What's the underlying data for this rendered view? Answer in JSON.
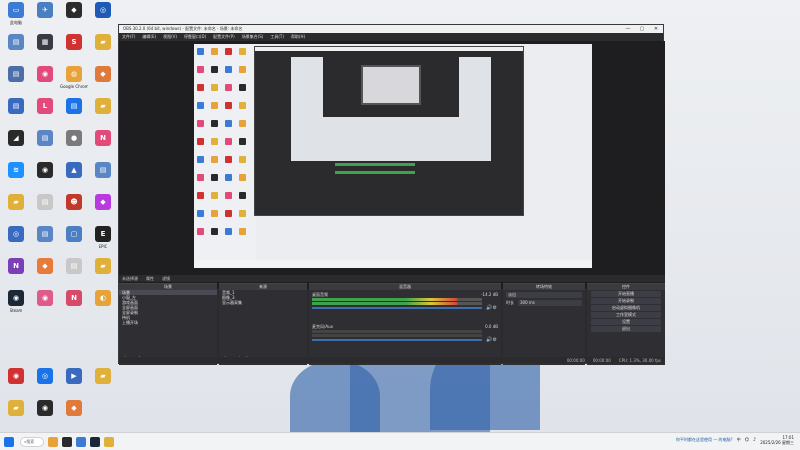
{
  "desktop": {
    "icons": [
      {
        "label": "此电脑",
        "color": "#3b7bd4",
        "glyph": "▭",
        "icon": "computer-icon"
      },
      {
        "label": "",
        "color": "#4a7fc1",
        "glyph": "✈",
        "icon": "app-icon"
      },
      {
        "label": "",
        "color": "#2c2c2c",
        "glyph": "◆",
        "icon": "app-icon"
      },
      {
        "label": "",
        "color": "#1e5bb8",
        "glyph": "◎",
        "icon": "app-icon"
      },
      {
        "label": "",
        "color": "#5a86c5",
        "glyph": "▤",
        "icon": "app-icon"
      },
      {
        "label": "",
        "color": "#3a3a44",
        "glyph": "▦",
        "icon": "app-icon"
      },
      {
        "label": "",
        "color": "#d03232",
        "glyph": "S",
        "icon": "app-icon"
      },
      {
        "label": "",
        "color": "#e0b13a",
        "glyph": "▰",
        "icon": "folder-icon"
      },
      {
        "label": "",
        "color": "#4d6fa8",
        "glyph": "▤",
        "icon": "app-icon"
      },
      {
        "label": "",
        "color": "#e24a7a",
        "glyph": "◉",
        "icon": "app-icon"
      },
      {
        "label": "Google Chrome",
        "color": "#e8a23a",
        "glyph": "◍",
        "icon": "chrome-icon"
      },
      {
        "label": "",
        "color": "#e07a3a",
        "glyph": "◆",
        "icon": "app-icon"
      },
      {
        "label": "",
        "color": "#3a6ac0",
        "glyph": "▤",
        "icon": "app-icon"
      },
      {
        "label": "",
        "color": "#e24a7a",
        "glyph": "L",
        "icon": "app-icon"
      },
      {
        "label": "",
        "color": "#1a73e8",
        "glyph": "▤",
        "icon": "app-icon"
      },
      {
        "label": "",
        "color": "#e0b13a",
        "glyph": "▰",
        "icon": "folder-icon"
      },
      {
        "label": "",
        "color": "#2a2a2a",
        "glyph": "◢",
        "icon": "app-icon"
      },
      {
        "label": "",
        "color": "#5a86c5",
        "glyph": "▤",
        "icon": "app-icon"
      },
      {
        "label": "",
        "color": "#7a7a7a",
        "glyph": "●",
        "icon": "app-icon"
      },
      {
        "label": "",
        "color": "#e24a7a",
        "glyph": "N",
        "icon": "app-icon"
      },
      {
        "label": "",
        "color": "#1e90ff",
        "glyph": "≋",
        "icon": "app-icon"
      },
      {
        "label": "",
        "color": "#2a2a2a",
        "glyph": "◉",
        "icon": "app-icon"
      },
      {
        "label": "",
        "color": "#3a6ac0",
        "glyph": "▲",
        "icon": "app-icon"
      },
      {
        "label": "",
        "color": "#5a86c5",
        "glyph": "▤",
        "icon": "app-icon"
      },
      {
        "label": "",
        "color": "#e0b13a",
        "glyph": "▰",
        "icon": "folder-icon"
      },
      {
        "label": "",
        "color": "#c8c8c8",
        "glyph": "▤",
        "icon": "file-icon"
      },
      {
        "label": "",
        "color": "#c0392b",
        "glyph": "☻",
        "icon": "app-icon"
      },
      {
        "label": "",
        "color": "#b83be0",
        "glyph": "◆",
        "icon": "app-icon"
      },
      {
        "label": "",
        "color": "#3a6ac0",
        "glyph": "◎",
        "icon": "app-icon"
      },
      {
        "label": "",
        "color": "#5a86c5",
        "glyph": "▤",
        "icon": "app-icon"
      },
      {
        "label": "",
        "color": "#4a7fc1",
        "glyph": "▢",
        "icon": "app-icon"
      },
      {
        "label": "EPIC",
        "color": "#222",
        "glyph": "E",
        "icon": "epic-games-icon"
      },
      {
        "label": "",
        "color": "#7b3fb8",
        "glyph": "N",
        "icon": "app-icon"
      },
      {
        "label": "",
        "color": "#e87a3a",
        "glyph": "◆",
        "icon": "app-icon"
      },
      {
        "label": "",
        "color": "#c8c8c8",
        "glyph": "▤",
        "icon": "file-icon"
      },
      {
        "label": "",
        "color": "#e0b13a",
        "glyph": "▰",
        "icon": "folder-icon"
      },
      {
        "label": "Steam",
        "color": "#1b2838",
        "glyph": "◉",
        "icon": "steam-icon"
      },
      {
        "label": "",
        "color": "#e05a8a",
        "glyph": "◉",
        "icon": "app-icon"
      },
      {
        "label": "",
        "color": "#d84a6a",
        "glyph": "N",
        "icon": "app-icon"
      },
      {
        "label": "",
        "color": "#e8a23a",
        "glyph": "◐",
        "icon": "app-icon"
      }
    ],
    "left_column": [
      {
        "label": "",
        "color": "#d03232",
        "glyph": "◉",
        "icon": "app-icon"
      },
      {
        "label": "",
        "color": "#1a73e8",
        "glyph": "◎",
        "icon": "app-icon"
      },
      {
        "label": "",
        "color": "#3a6ac0",
        "glyph": "▶",
        "icon": "app-icon"
      },
      {
        "label": "",
        "color": "#e0b13a",
        "glyph": "▰",
        "icon": "folder-icon"
      },
      {
        "label": "",
        "color": "#e0b13a",
        "glyph": "▰",
        "icon": "folder-icon"
      },
      {
        "label": "",
        "color": "#2a2a2a",
        "glyph": "◉",
        "icon": "app-icon"
      },
      {
        "label": "",
        "color": "#e07a3a",
        "glyph": "◆",
        "icon": "app-icon"
      }
    ]
  },
  "obs": {
    "title": "OBS 30.2.0 (64 bit, windows) - 配置文件: 未命名 - 场景: 未命名",
    "menus": [
      "文件(F)",
      "编辑(E)",
      "视图(V)",
      "停靠窗口(D)",
      "配置文件(P)",
      "场景集合(S)",
      "工具(T)",
      "帮助(H)"
    ],
    "window_buttons": {
      "min": "—",
      "max": "▢",
      "close": "✕"
    },
    "context_bar": {
      "label": "未选择源",
      "properties": "属性",
      "filters": "滤镜"
    },
    "scenes": {
      "header": "场景",
      "items": [
        "场景",
        "小窗_左",
        "游戏画面",
        "全屏画面",
        "全屏录制",
        "待机",
        "上播开场"
      ]
    },
    "sources": {
      "header": "来源",
      "items": [
        "音频_1",
        "图像_3",
        "显示器采集"
      ]
    },
    "mixer": {
      "header": "混音器",
      "channels": [
        {
          "name": "桌面音频",
          "db": "-14.2 dB"
        },
        {
          "name": "麦克风/Aux",
          "db": "0.0 dB"
        }
      ]
    },
    "transitions": {
      "header": "转场特效",
      "type": "淡出",
      "duration_label": "时长",
      "duration": "300 ms"
    },
    "controls": {
      "header": "控件",
      "buttons": [
        "开始直播",
        "开始录制",
        "启动虚拟摄像机",
        "工作室模式",
        "设置",
        "退出"
      ]
    },
    "status": {
      "cpu": "CPU: 1.3%, 30.00 fps",
      "live": "00:00:00",
      "rec": "00:00:00"
    }
  },
  "taskbar": {
    "search_placeholder": "搜索",
    "notice": "你平时都在这里使用 — 的电脑?",
    "lang": "中",
    "time": "17:01",
    "date": "2025/2/26 星期三"
  }
}
